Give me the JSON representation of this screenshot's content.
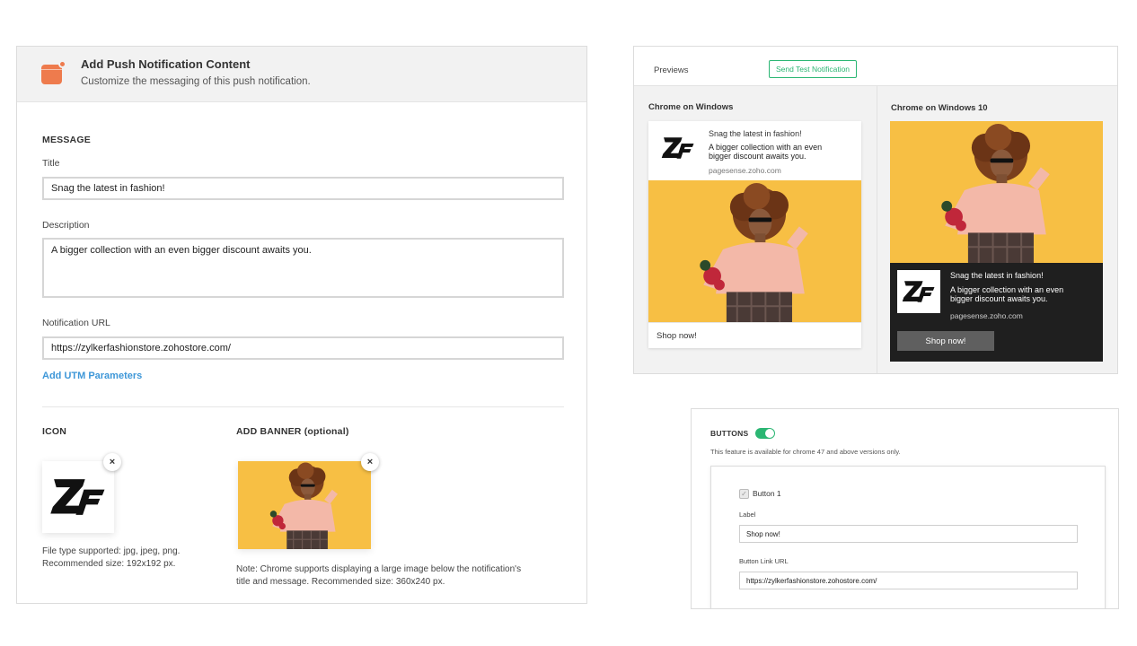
{
  "content_panel": {
    "title": "Add Push Notification Content",
    "subtitle": "Customize the messaging of this push notification.",
    "message_section": "MESSAGE",
    "title_label": "Title",
    "title_value": "Snag the latest in fashion!",
    "description_label": "Description",
    "description_value": "A bigger collection with an even bigger discount awaits you.",
    "url_label": "Notification URL",
    "url_value": "https://zylkerfashionstore.zohostore.com/",
    "utm_link": "Add UTM Parameters",
    "icon_section": "ICON",
    "icon_note_line1": "File type supported: jpg, jpeg, png.",
    "icon_note_line2": "Recommended size: 192x192 px.",
    "banner_section": "ADD BANNER (optional)",
    "banner_note_line1": "Note: Chrome supports displaying a large image below the notification's",
    "banner_note_line2": "title and message. Recommended size: 360x240 px.",
    "close_glyph": "×",
    "accent_color": "#ee7b4d"
  },
  "preview_panel": {
    "tab_label": "Previews",
    "test_button": "Send Test Notification",
    "chrome_windows": {
      "label": "Chrome on Windows",
      "title": "Snag the latest in fashion!",
      "body_line1": "A bigger collection with an even",
      "body_line2": "bigger discount awaits you.",
      "site": "pagesense.zoho.com",
      "action": "Shop now!"
    },
    "chrome_windows_10": {
      "label": "Chrome on Windows 10",
      "title": "Snag the latest in fashion!",
      "body_line1": "A bigger collection with an even",
      "body_line2": "bigger discount awaits you.",
      "site": "pagesense.zoho.com",
      "action": "Shop now!"
    },
    "test_button_color": "#2bb673"
  },
  "buttons_panel": {
    "section": "BUTTONS",
    "toggle_on": true,
    "info": "This feature is available for chrome 47 and above versions only.",
    "button1_label": "Button 1",
    "label_field": "Label",
    "label_value": "Shop now!",
    "link_field": "Button Link URL",
    "link_value": "https://zylkerfashionstore.zohostore.com/",
    "check_glyph": "✓"
  }
}
